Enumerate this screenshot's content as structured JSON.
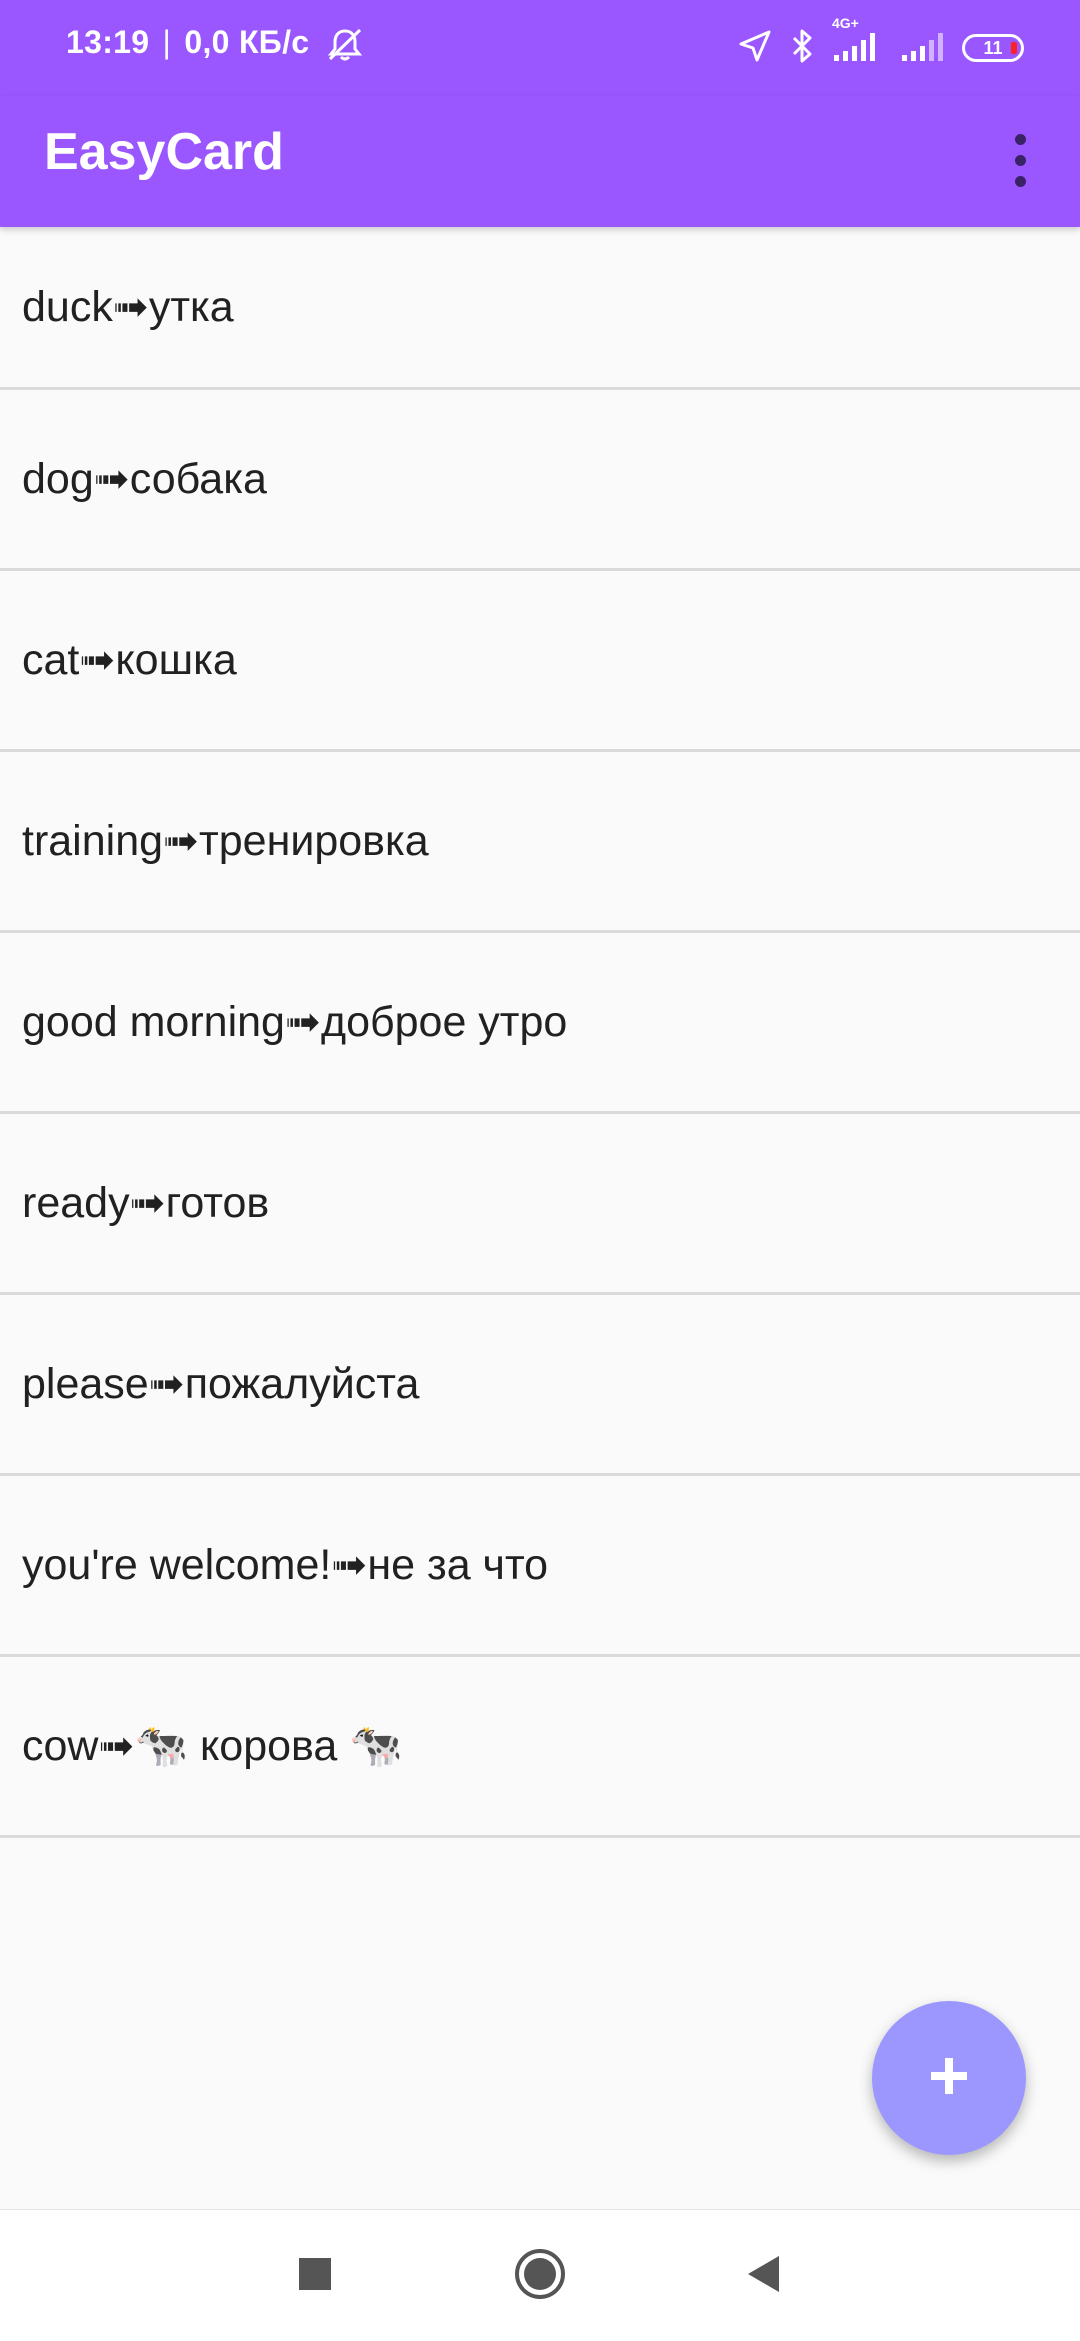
{
  "status_bar": {
    "time": "13:19",
    "separator": "|",
    "data_speed": "0,0 КБ/с",
    "network_type": "4G+",
    "battery_level": "11",
    "battery_level_fraction": 0.11,
    "battery_low_color": "#FF2222",
    "icons": [
      "mute-bell-icon",
      "location-icon",
      "bluetooth-icon",
      "signal-icon",
      "signal-icon",
      "battery-icon"
    ]
  },
  "app_bar": {
    "title": "EasyCard",
    "menu_icon": "more-vert-icon",
    "background_color": "#9A56FF"
  },
  "cards": [
    {
      "text": "duck➟утка"
    },
    {
      "text": "dog➟собака"
    },
    {
      "text": "cat➟кошка"
    },
    {
      "text": "training➟тренировка"
    },
    {
      "text": "good morning➟доброе утро"
    },
    {
      "text": "ready➟готов"
    },
    {
      "text": "please➟пожалуйста"
    },
    {
      "text": "you're welcome!➟не за что"
    },
    {
      "text": "cow➟🐄 корова 🐄"
    }
  ],
  "fab": {
    "icon": "plus-icon",
    "color": "#9B97FF"
  },
  "nav_bar": {
    "buttons": [
      "recents-square-icon",
      "home-circle-icon",
      "back-triangle-icon"
    ]
  }
}
